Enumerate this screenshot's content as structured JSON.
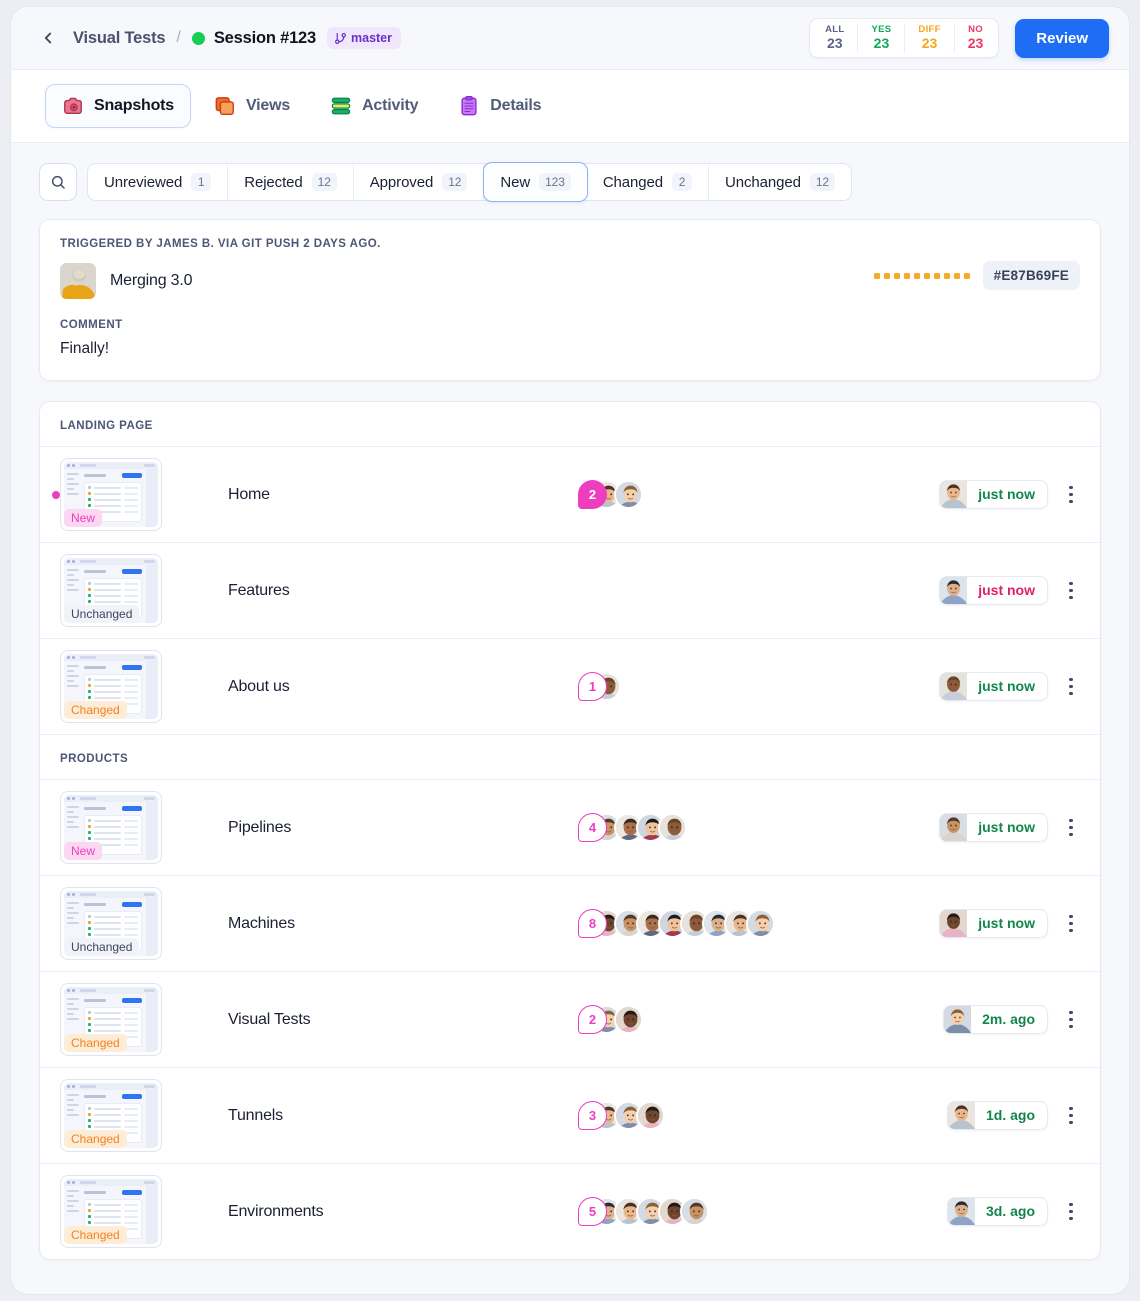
{
  "header": {
    "back_icon": "chevron-left-icon",
    "breadcrumb_parent": "Visual Tests",
    "breadcrumb_sep": "/",
    "session_title": "Session #123",
    "branch_label": "master",
    "branch_icon": "git-branch-icon",
    "counts": [
      {
        "label": "ALL",
        "value": "23",
        "color": "#5b6480"
      },
      {
        "label": "YES",
        "value": "23",
        "color": "#0fa958"
      },
      {
        "label": "DIFF",
        "value": "23",
        "color": "#f3a81b"
      },
      {
        "label": "NO",
        "value": "23",
        "color": "#ef3866"
      }
    ],
    "review_label": "Review"
  },
  "tabs": [
    {
      "label": "Snapshots",
      "icon": "camera-icon",
      "active": true
    },
    {
      "label": "Views",
      "icon": "cards-icon",
      "active": false
    },
    {
      "label": "Activity",
      "icon": "layers-icon",
      "active": false
    },
    {
      "label": "Details",
      "icon": "clipboard-icon",
      "active": false
    }
  ],
  "filters": {
    "search_icon": "search-icon",
    "chips": [
      {
        "label": "Unreviewed",
        "count": "1",
        "active": false
      },
      {
        "label": "Rejected",
        "count": "12",
        "active": false
      },
      {
        "label": "Approved",
        "count": "12",
        "active": false
      },
      {
        "label": "New",
        "count": "123",
        "active": true
      },
      {
        "label": "Changed",
        "count": "2",
        "active": false
      },
      {
        "label": "Unchanged",
        "count": "12",
        "active": false
      }
    ]
  },
  "trigger": {
    "eyebrow": "TRIGGERED BY JAMES B. VIA GIT PUSH 2 DAYS AGO.",
    "title": "Merging 3.0",
    "commit_hash": "#E87B69FE",
    "comment_label": "COMMENT",
    "comment_text": "Finally!"
  },
  "groups": [
    {
      "title": "LANDING PAGE",
      "rows": [
        {
          "name": "Home",
          "badge": "New",
          "badge_kind": "new",
          "dot": true,
          "count": "2",
          "count_style": "filled",
          "avatars": 2,
          "time": "just now",
          "time_color": "green",
          "menu_icon": "kebab-menu-icon"
        },
        {
          "name": "Features",
          "badge": "Unchanged",
          "badge_kind": "unchanged",
          "dot": false,
          "count": "",
          "count_style": "none",
          "avatars": 0,
          "time": "just now",
          "time_color": "pink",
          "menu_icon": "kebab-menu-icon"
        },
        {
          "name": "About us",
          "badge": "Changed",
          "badge_kind": "changed",
          "dot": false,
          "count": "1",
          "count_style": "outline",
          "avatars": 1,
          "time": "just now",
          "time_color": "green",
          "menu_icon": "kebab-menu-icon"
        }
      ]
    },
    {
      "title": "PRODUCTS",
      "rows": [
        {
          "name": "Pipelines",
          "badge": "New",
          "badge_kind": "new",
          "dot": false,
          "count": "4",
          "count_style": "outline",
          "avatars": 4,
          "time": "just now",
          "time_color": "green",
          "menu_icon": "kebab-menu-icon"
        },
        {
          "name": "Machines",
          "badge": "Unchanged",
          "badge_kind": "unchanged",
          "dot": false,
          "count": "8",
          "count_style": "outline",
          "avatars": 8,
          "time": "just now",
          "time_color": "green",
          "menu_icon": "kebab-menu-icon"
        },
        {
          "name": "Visual Tests",
          "badge": "Changed",
          "badge_kind": "changed",
          "dot": false,
          "count": "2",
          "count_style": "outline",
          "avatars": 2,
          "time": "2m. ago",
          "time_color": "green",
          "menu_icon": "kebab-menu-icon"
        },
        {
          "name": "Tunnels",
          "badge": "Changed",
          "badge_kind": "changed",
          "dot": false,
          "count": "3",
          "count_style": "outline",
          "avatars": 3,
          "time": "1d. ago",
          "time_color": "green",
          "menu_icon": "kebab-menu-icon"
        },
        {
          "name": "Environments",
          "badge": "Changed",
          "badge_kind": "changed",
          "dot": false,
          "count": "5",
          "count_style": "outline",
          "avatars": 5,
          "time": "3d. ago",
          "time_color": "green",
          "menu_icon": "kebab-menu-icon"
        }
      ]
    }
  ],
  "colors": {
    "accent_blue": "#1f6df5",
    "magenta": "#ee3ec0",
    "orange": "#f0821d",
    "green": "#12864b",
    "pink": "#e01f68"
  }
}
